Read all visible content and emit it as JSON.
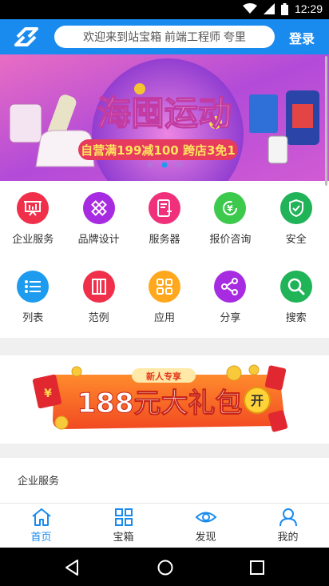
{
  "status": {
    "time": "12:29"
  },
  "header": {
    "search_placeholder": "欢迎来到站宝箱 前端工程师 夸里",
    "login_label": "登录"
  },
  "banner": {
    "title": "海囤运动",
    "subtitle": "自营满199减100 跨店3免1",
    "dots": 3,
    "active_dot": 1
  },
  "grid_row1": [
    {
      "label": "企业服务",
      "color": "#F0304A",
      "icon": "presentation-icon"
    },
    {
      "label": "品牌设计",
      "color": "#A72BE0",
      "icon": "pencil-ruler-icon"
    },
    {
      "label": "服务器",
      "color": "#F0307A",
      "icon": "server-icon"
    },
    {
      "label": "报价咨询",
      "color": "#3DC94C",
      "icon": "yen-refresh-icon"
    },
    {
      "label": "安全",
      "color": "#20B358",
      "icon": "shield-check-icon"
    }
  ],
  "grid_row2": [
    {
      "label": "列表",
      "color": "#1C9BEF",
      "icon": "list-icon"
    },
    {
      "label": "范例",
      "color": "#F0304A",
      "icon": "book-icon"
    },
    {
      "label": "应用",
      "color": "#FFA81E",
      "icon": "apps-icon"
    },
    {
      "label": "分享",
      "color": "#A72BE0",
      "icon": "share-icon"
    },
    {
      "label": "搜索",
      "color": "#20B358",
      "icon": "search-icon"
    }
  ],
  "promo": {
    "tag": "新人专享",
    "text": "188元大礼包",
    "open": "开"
  },
  "section": {
    "title": "企业服务"
  },
  "tabs": [
    {
      "label": "首页",
      "icon": "home-icon",
      "active": true
    },
    {
      "label": "宝箱",
      "icon": "grid-icon",
      "active": false
    },
    {
      "label": "发现",
      "icon": "eye-icon",
      "active": false
    },
    {
      "label": "我的",
      "icon": "person-icon",
      "active": false
    }
  ],
  "colors": {
    "primary": "#1A8BEE",
    "tab_active": "#1A8BEE",
    "tab_inactive": "#1A8BEE"
  }
}
